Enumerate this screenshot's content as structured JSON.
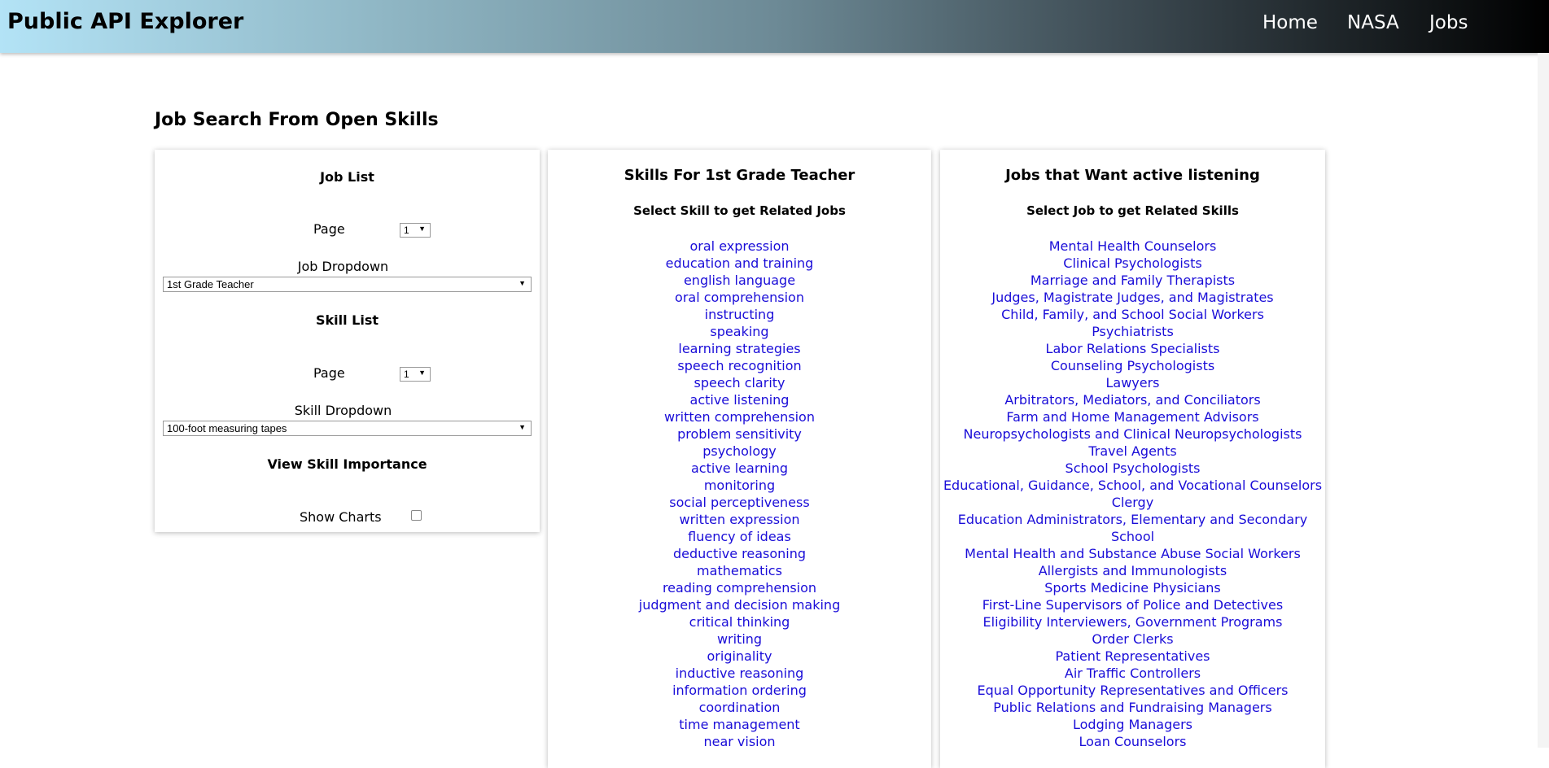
{
  "navbar": {
    "brand": "Public API Explorer",
    "links": [
      "Home",
      "NASA",
      "Jobs"
    ]
  },
  "page_title": "Job Search From Open Skills",
  "left_panel": {
    "job_list_heading": "Job List",
    "page_label_1": "Page",
    "page_value_1": "1",
    "job_dropdown_label": "Job Dropdown",
    "job_dropdown_value": "1st Grade Teacher",
    "skill_list_heading": "Skill List",
    "page_label_2": "Page",
    "page_value_2": "1",
    "skill_dropdown_label": "Skill Dropdown",
    "skill_dropdown_value": "100-foot measuring tapes",
    "importance_heading": "View Skill Importance",
    "show_charts_label": "Show Charts"
  },
  "mid_panel": {
    "title": "Skills For 1st Grade Teacher",
    "subtitle": "Select Skill to get Related Jobs",
    "skills": [
      "oral expression",
      "education and training",
      "english language",
      "oral comprehension",
      "instructing",
      "speaking",
      "learning strategies",
      "speech recognition",
      "speech clarity",
      "active listening",
      "written comprehension",
      "problem sensitivity",
      "psychology",
      "active learning",
      "monitoring",
      "social perceptiveness",
      "written expression",
      "fluency of ideas",
      "deductive reasoning",
      "mathematics",
      "reading comprehension",
      "judgment and decision making",
      "critical thinking",
      "writing",
      "originality",
      "inductive reasoning",
      "information ordering",
      "coordination",
      "time management",
      "near vision"
    ]
  },
  "right_panel": {
    "title": "Jobs that Want active listening",
    "subtitle": "Select Job to get Related Skills",
    "jobs": [
      "Mental Health Counselors",
      "Clinical Psychologists",
      "Marriage and Family Therapists",
      "Judges, Magistrate Judges, and Magistrates",
      "Child, Family, and School Social Workers",
      "Psychiatrists",
      "Labor Relations Specialists",
      "Counseling Psychologists",
      "Lawyers",
      "Arbitrators, Mediators, and Conciliators",
      "Farm and Home Management Advisors",
      "Neuropsychologists and Clinical Neuropsychologists",
      "Travel Agents",
      "School Psychologists",
      "Educational, Guidance, School, and Vocational Counselors",
      "Clergy",
      "Education Administrators, Elementary and Secondary",
      "School",
      "Mental Health and Substance Abuse Social Workers",
      "Allergists and Immunologists",
      "Sports Medicine Physicians",
      "First-Line Supervisors of Police and Detectives",
      "Eligibility Interviewers, Government Programs",
      "Order Clerks",
      "Patient Representatives",
      "Air Traffic Controllers",
      "Equal Opportunity Representatives and Officers",
      "Public Relations and Fundraising Managers",
      "Lodging Managers",
      "Loan Counselors"
    ]
  }
}
